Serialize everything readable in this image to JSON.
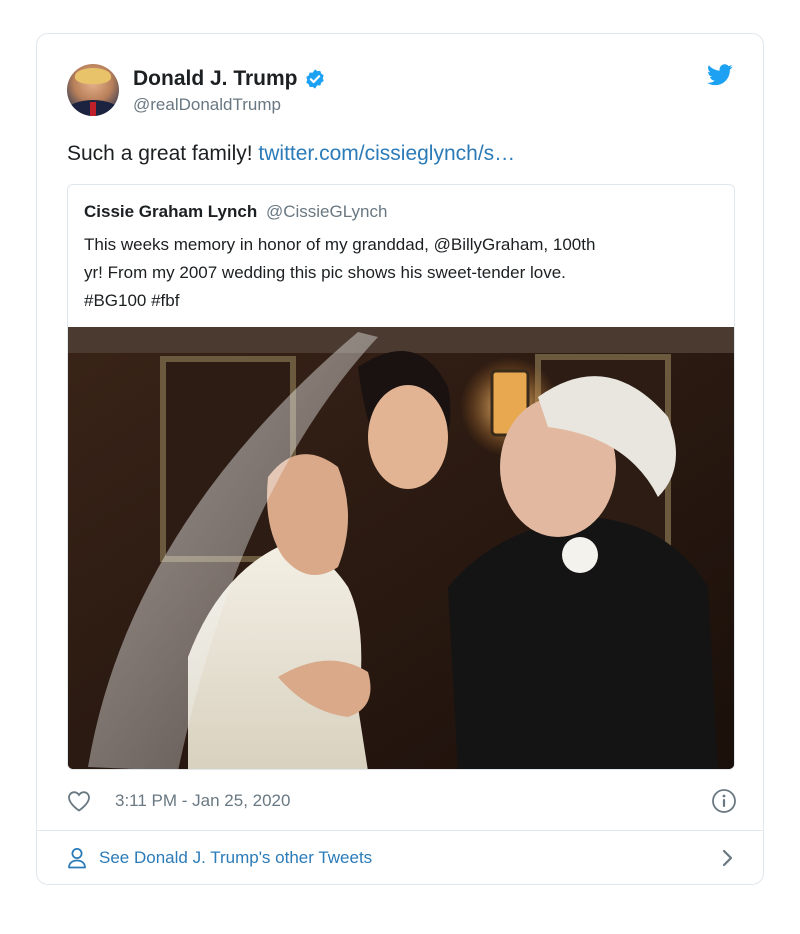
{
  "author": {
    "display_name": "Donald J. Trump",
    "handle": "@realDonaldTrump",
    "verified": true,
    "avatar_icon": "profile-photo"
  },
  "tweet": {
    "text": "Such a great family! ",
    "link_text": "twitter.com/cissieglynch/s…"
  },
  "quoted_tweet": {
    "display_name": "Cissie Graham Lynch",
    "handle": "@CissieGLynch",
    "text_line_1": "This weeks memory in honor of my granddad, @BillyGraham,  100th",
    "text_line_2": "yr! From my 2007 wedding this pic shows his sweet-tender love.",
    "text_line_3": "#BG100 #fbf",
    "image": "wedding-photo"
  },
  "meta": {
    "timestamp": "3:11 PM - Jan 25, 2020",
    "like_icon": "heart-icon",
    "info_icon": "info-icon"
  },
  "footer": {
    "other_tweets_label": "See Donald J. Trump's other Tweets",
    "person_icon": "person-icon",
    "chevron_icon": "chevron-right-icon"
  },
  "colors": {
    "link": "#2b7bb9",
    "twitter_blue": "#1da1f2",
    "secondary_text": "#697882",
    "border": "#e1e8ed"
  }
}
